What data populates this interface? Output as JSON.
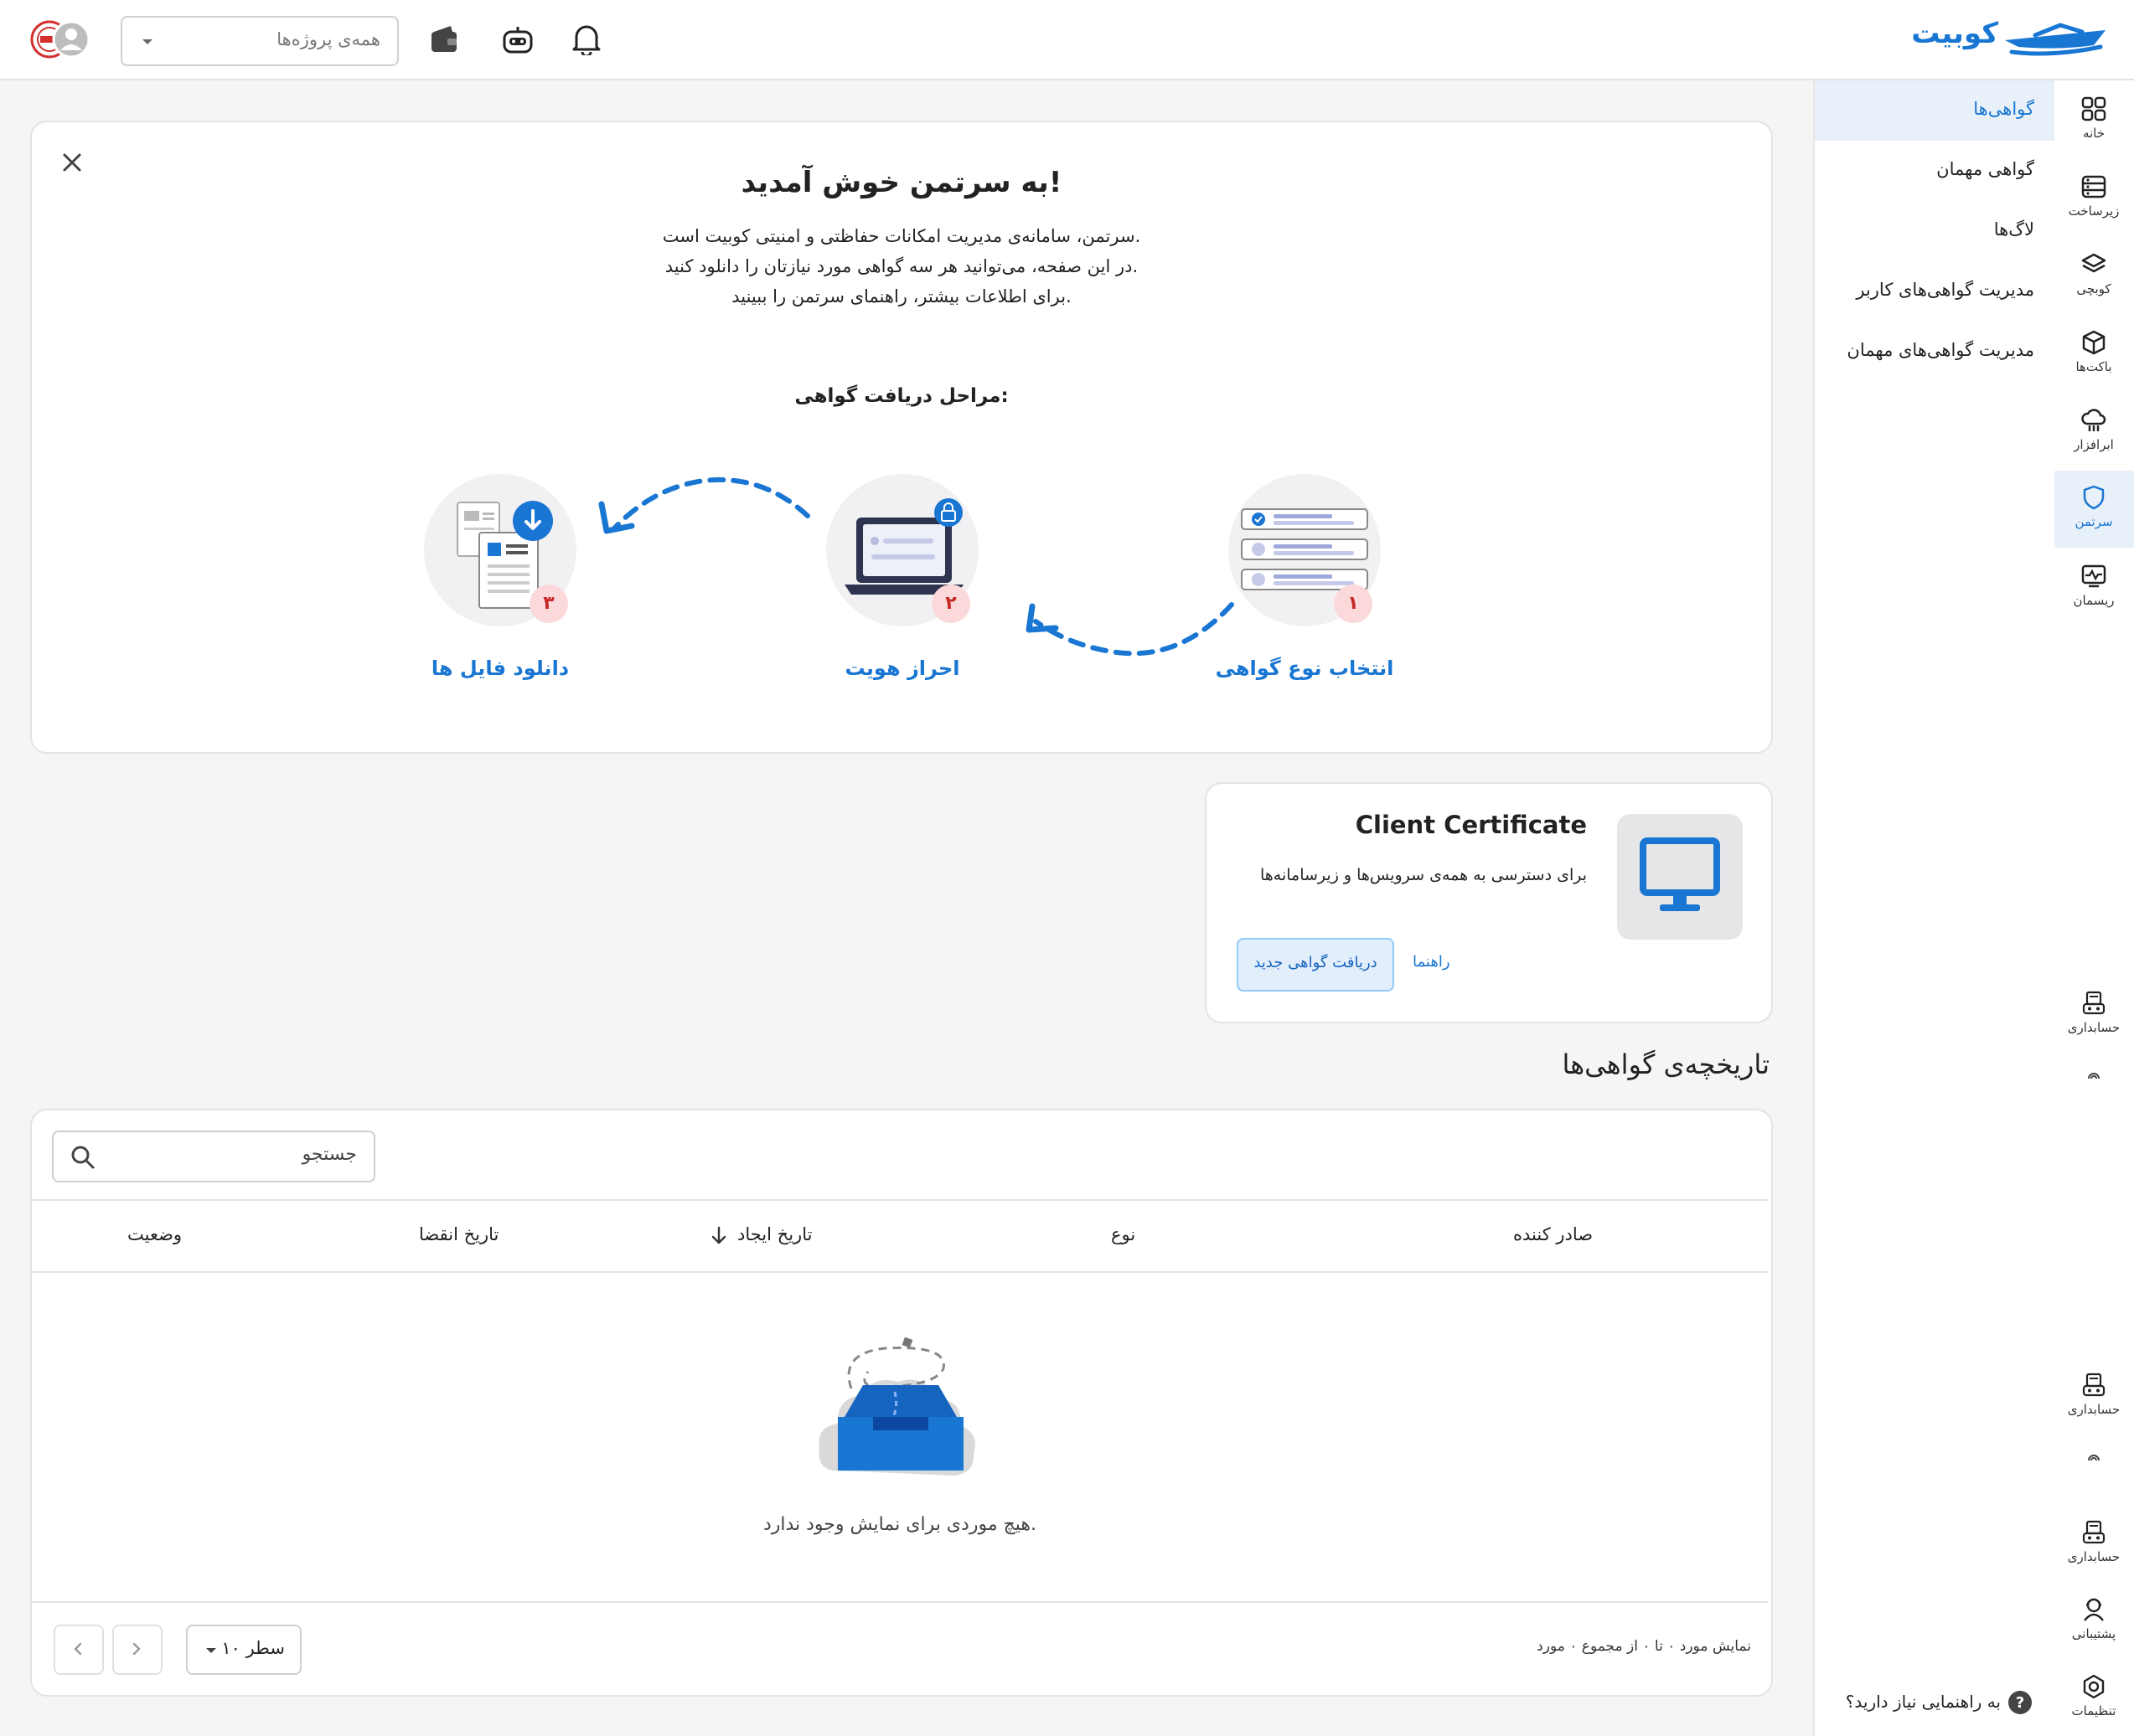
{
  "header": {
    "brand": "کوبیت",
    "project_select": {
      "placeholder": "همه‌ی پروژه‌ها"
    }
  },
  "rail": {
    "items": [
      {
        "label": "خانه",
        "icon": "grid-icon"
      },
      {
        "label": "زیرساخت",
        "icon": "server-icon"
      },
      {
        "label": "کوبچی",
        "icon": "layers-icon"
      },
      {
        "label": "باکت‌ها",
        "icon": "box-icon"
      },
      {
        "label": "ابرافزار",
        "icon": "cloud-icon"
      },
      {
        "label": "سرتمن",
        "icon": "shield-icon"
      },
      {
        "label": "ریسمان",
        "icon": "monitor-pulse-icon"
      },
      {
        "label": "حسابداری",
        "icon": "accounting-icon"
      },
      {
        "label": "حسابداری",
        "icon": "accounting-icon"
      },
      {
        "label": "حسابداری",
        "icon": "accounting-icon"
      },
      {
        "label": "پشتیبانی",
        "icon": "support-icon"
      },
      {
        "label": "تنظیمات",
        "icon": "settings-icon"
      }
    ]
  },
  "subnav": {
    "items": [
      "گواهی‌ها",
      "گواهی مهمان",
      "لاگ‌ها",
      "مدیریت گواهی‌های کاربر",
      "مدیریت گواهی‌های مهمان"
    ],
    "help": "به راهنمایی نیاز دارید؟"
  },
  "welcome": {
    "title": "به سرتمن خوش آمدید!",
    "line1": "سرتمن، سامانه‌ی مدیریت امکانات حفاظتی و امنیتی کوبیت است.",
    "line2": "در این صفحه، می‌توانید هر سه گواهی مورد نیازتان را دانلود کنید.",
    "line3": "برای اطلاعات بیشتر، راهنمای سرتمن را ببینید.",
    "steps_heading": "مراحل دریافت گواهی:",
    "steps": [
      {
        "number": "۱",
        "title": "انتخاب نوع گواهی"
      },
      {
        "number": "۲",
        "title": "احراز هویت"
      },
      {
        "number": "۳",
        "title": "دانلود فایل ها"
      }
    ]
  },
  "client_cert": {
    "title": "Client Certificate",
    "description": "برای دسترسی به همه‌ی سرویس‌ها و زیرسامانه‌ها",
    "new_button": "دریافت گواهی جدید",
    "guide_link": "راهنما"
  },
  "history": {
    "title": "تاریخچه‌ی گواهی‌ها",
    "search_placeholder": "جستجو",
    "columns": {
      "issuer": "صادر کننده",
      "type": "نوع",
      "created": "تاریخ ایجاد",
      "expires": "تاریخ انقضا",
      "status": "وضعیت"
    },
    "empty_text": "هیچ موردی برای نمایش وجود ندارد.",
    "pagination": {
      "summary": "نمایش مورد ۰ تا ۰ از مجموع ۰ مورد",
      "rows_per_page": "۱۰ سطر"
    }
  },
  "colors": {
    "accent": "#1976d2",
    "accent_light": "#e8f0fa",
    "badge_bg": "#fbd9db"
  }
}
